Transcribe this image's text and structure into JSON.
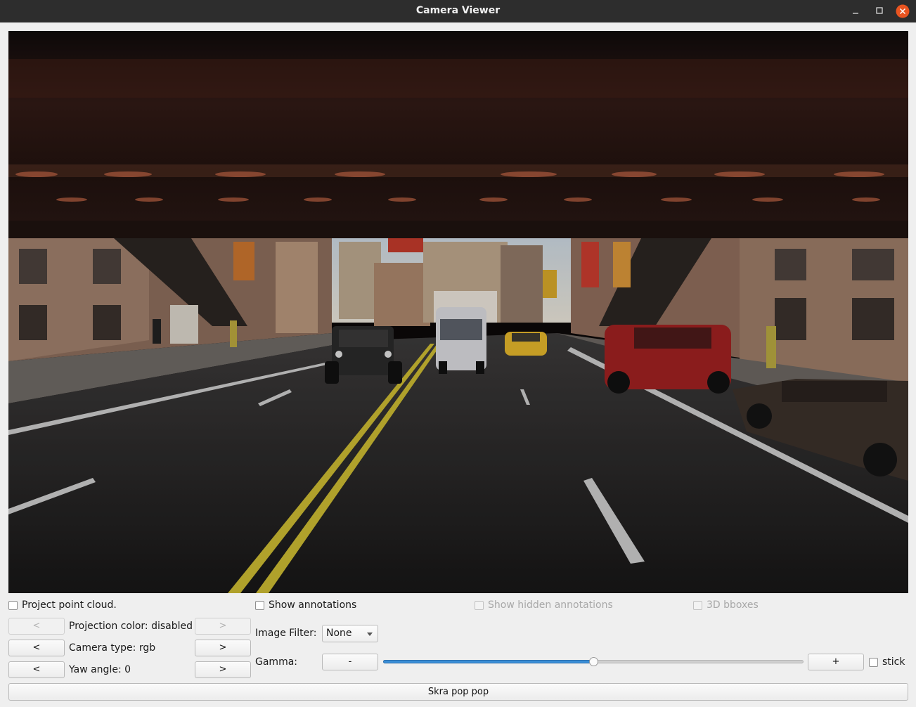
{
  "window": {
    "title": "Camera Viewer",
    "controls": [
      "minimize-icon",
      "maximize-icon",
      "close-icon"
    ],
    "close_color": "#e95420"
  },
  "viewport": {
    "scene": "camera-frame-street-under-elevated-track"
  },
  "options": {
    "project_point_cloud": {
      "label": "Project point cloud.",
      "checked": false
    },
    "show_annotations": {
      "label": "Show annotations",
      "checked": false
    },
    "show_hidden_annotations": {
      "label": "Show hidden annotations",
      "checked": false,
      "enabled": false
    },
    "bboxes_3d": {
      "label": "3D bboxes",
      "checked": false,
      "enabled": false
    }
  },
  "projection": {
    "prev": "<",
    "label": "Projection color: disabled",
    "next": ">",
    "enabled": false
  },
  "camera": {
    "prev": "<",
    "label": "Camera type: rgb",
    "next": ">"
  },
  "yaw": {
    "prev": "<",
    "label": "Yaw angle: 0",
    "next": ">"
  },
  "image_filter": {
    "label": "Image Filter:",
    "value": "None"
  },
  "gamma": {
    "label": "Gamma:",
    "minus": "-",
    "plus": "+",
    "level": 0.5,
    "stick_label": "stick",
    "stick_checked": false
  },
  "action_button": "Skra pop pop",
  "colors": {
    "titlebar": "#2d2d2d",
    "slider_fill": "#3b8ed6",
    "lane_yellow": "#c9b832"
  }
}
